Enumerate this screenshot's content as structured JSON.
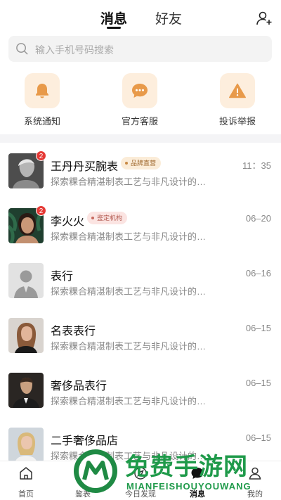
{
  "header": {
    "tabs": [
      "消息",
      "好友"
    ],
    "active_tab": 0,
    "add_friend_icon": "add-user-icon"
  },
  "search": {
    "placeholder": "输入手机号码搜索",
    "icon": "search-icon"
  },
  "quick_actions": [
    {
      "label": "系统通知",
      "icon": "bell-icon"
    },
    {
      "label": "官方客服",
      "icon": "chat-bubble-icon"
    },
    {
      "label": "投诉举报",
      "icon": "warning-icon"
    }
  ],
  "conversations": [
    {
      "name": "王丹丹买腕表",
      "tag": "品牌直营",
      "tag_style": "gold",
      "unread": "2",
      "preview": "探索粿合精湛制表工艺与非凡设计的奢...",
      "time": "11：35"
    },
    {
      "name": "李火火",
      "tag": "鉴定机构",
      "tag_style": "pink",
      "unread": "2",
      "preview": "探索粿合精湛制表工艺与非凡设计的奢...",
      "time": "06–20"
    },
    {
      "name": "表行",
      "tag": "",
      "unread": "",
      "preview": "探索粿合精湛制表工艺与非凡设计的奢...",
      "time": "06–16"
    },
    {
      "name": "名表表行",
      "tag": "",
      "unread": "",
      "preview": "探索粿合精湛制表工艺与非凡设计的奢...",
      "time": "06–15"
    },
    {
      "name": "奢侈品表行",
      "tag": "",
      "unread": "",
      "preview": "探索粿合精湛制表工艺与非凡设计的奢...",
      "time": "06–15"
    },
    {
      "name": "二手奢侈品店",
      "tag": "",
      "unread": "",
      "preview": "探索粿合精湛制表工艺与非凡设计的奢...",
      "time": "06–15"
    }
  ],
  "tabbar": [
    {
      "label": "首页",
      "icon": "home-icon"
    },
    {
      "label": "鉴表",
      "icon": "appraise-icon"
    },
    {
      "label": "今日发现",
      "icon": "discover-icon"
    },
    {
      "label": "消息",
      "icon": "message-icon",
      "active": true
    },
    {
      "label": "我的",
      "icon": "profile-icon"
    }
  ],
  "watermark": {
    "title": "免费手游网",
    "subtitle": "MIANFEISHOUYOUWANG"
  },
  "colors": {
    "accent_bg": "#fdeedd",
    "icon_orange": "#e89a4a",
    "badge_red": "#e53935"
  }
}
